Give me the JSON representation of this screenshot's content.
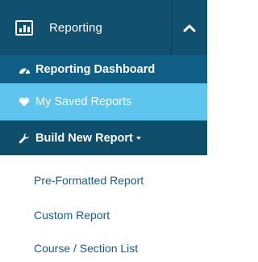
{
  "header": {
    "label": "Reporting",
    "icon": "bar-chart-icon",
    "toggle_icon": "chevron-up-icon"
  },
  "menu": {
    "dashboard": {
      "label": "Reporting Dashboard",
      "icon": "tachometer-icon"
    },
    "saved": {
      "label": "My Saved Reports",
      "icon": "heart-icon"
    },
    "build": {
      "label": "Build New Report",
      "icon": "wrench-icon"
    }
  },
  "submenu": [
    {
      "label": "Pre-Formatted Report"
    },
    {
      "label": "Custom Report"
    },
    {
      "label": "Course / Section List"
    }
  ],
  "colors": {
    "header_bg": "#11506e",
    "dashboard_bg": "#0f5e85",
    "active_bg": "#5ec6ee",
    "build_bg": "#0f4e6a",
    "link": "#1a5a86"
  }
}
